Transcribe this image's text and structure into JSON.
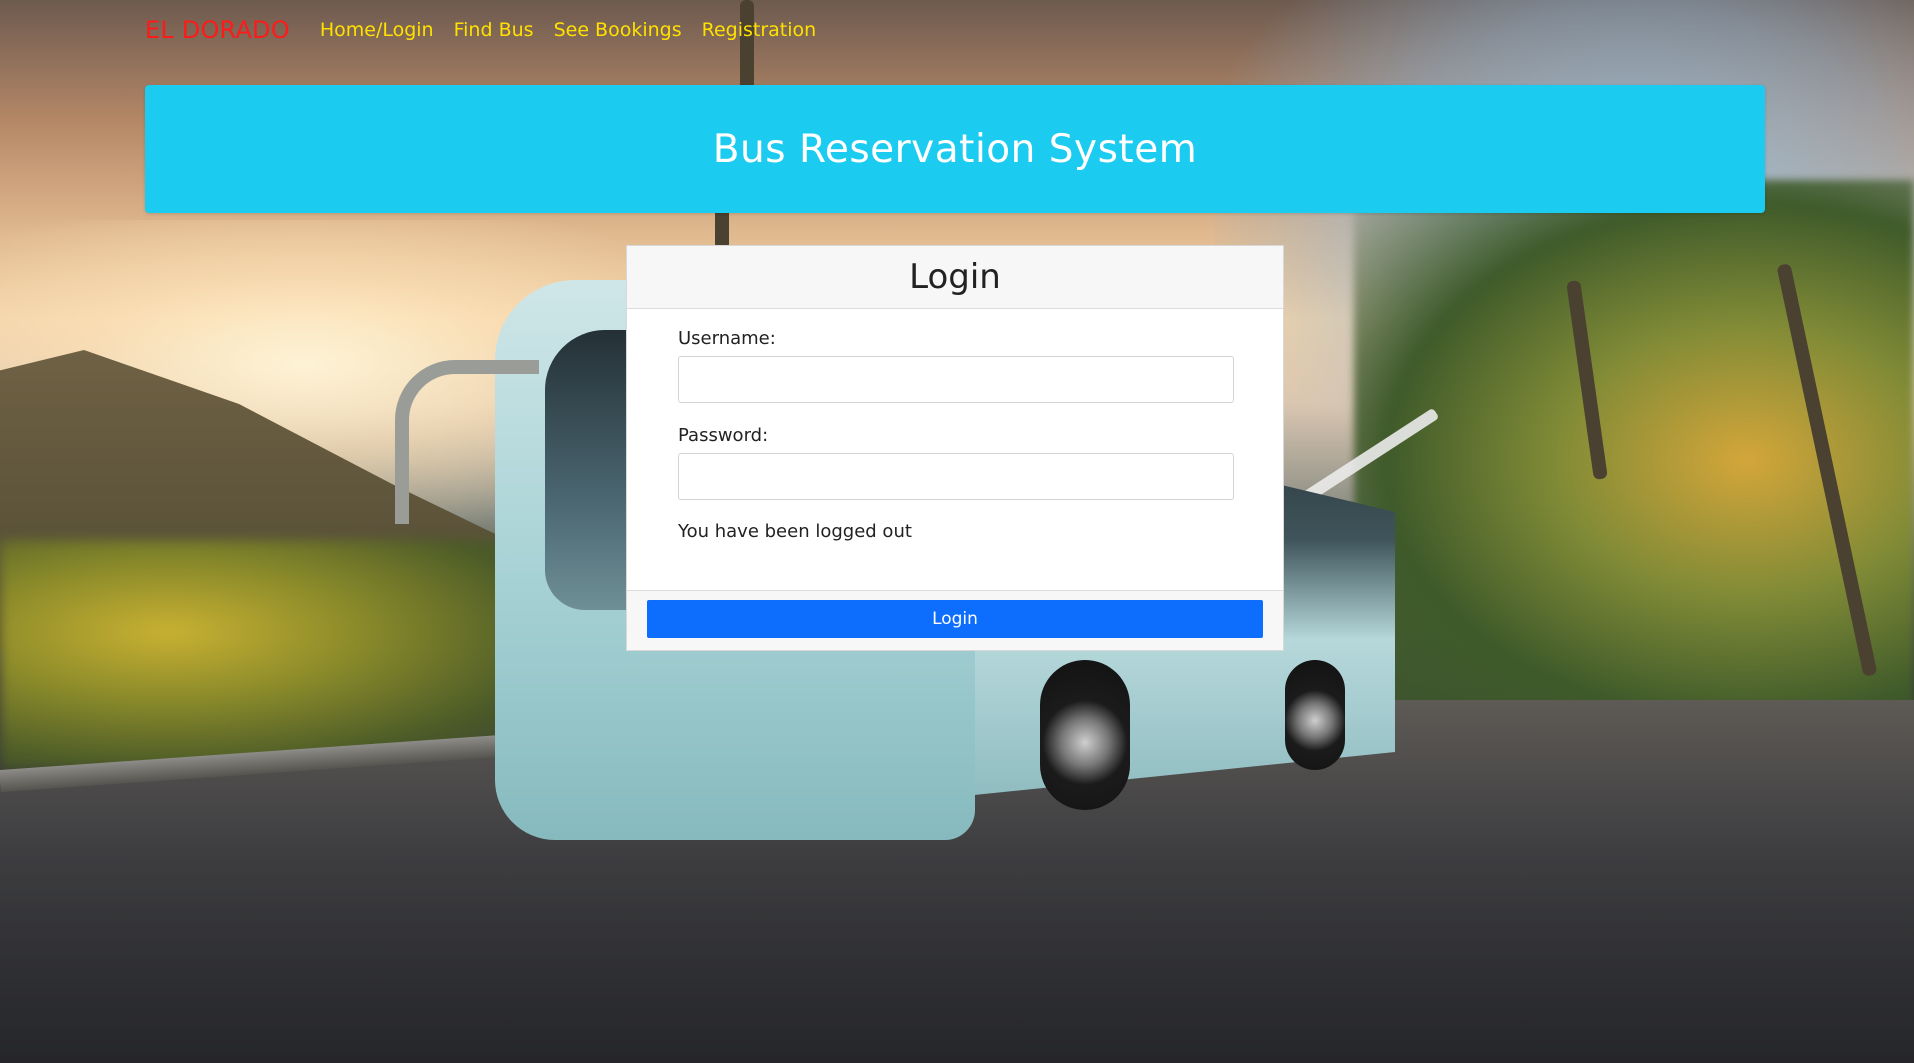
{
  "nav": {
    "brand": "EL DORADO",
    "links": [
      "Home/Login",
      "Find Bus",
      "See Bookings",
      "Registration"
    ]
  },
  "banner": {
    "title": "Bus Reservation System"
  },
  "login_card": {
    "title": "Login",
    "username_label": "Username:",
    "username_value": "",
    "password_label": "Password:",
    "password_value": "",
    "status_message": "You have been logged out",
    "submit_label": "Login"
  },
  "colors": {
    "brand": "#ff1a1a",
    "nav_link": "#ffe100",
    "banner_bg": "#1ccbf0",
    "button_bg": "#0d6efd"
  }
}
